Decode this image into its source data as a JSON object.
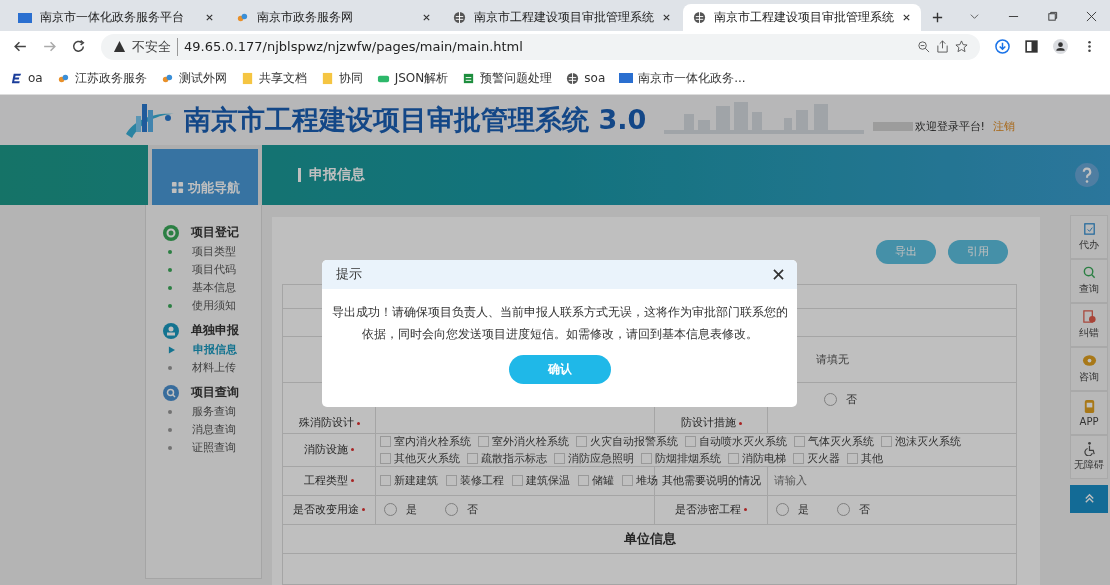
{
  "browser": {
    "tabs": [
      {
        "title": "南京市一体化政务服务平台",
        "selected": false
      },
      {
        "title": "南京市政务服务网",
        "selected": false
      },
      {
        "title": "南京市工程建设项目审批管理系统",
        "selected": false
      },
      {
        "title": "南京市工程建设项目审批管理系统",
        "selected": true
      }
    ],
    "security": "不安全",
    "url": "49.65.0.177/njblspwz/njzwfw/pages/main/main.html",
    "bookmarks": [
      "oa",
      "江苏政务服务",
      "测试外网",
      "共享文档",
      "协同",
      "JSON解析",
      "预警问题处理",
      "soa",
      "南京市一体化政务..."
    ]
  },
  "header": {
    "title": "南京市工程建设项目审批管理系统 3.0",
    "welcome": "欢迎登录平台!",
    "logout": "注销"
  },
  "nav_bar": {
    "heading": "功能导航",
    "section_title": "申报信息"
  },
  "sidebar": {
    "groups": [
      {
        "title": "项目登记",
        "items": [
          {
            "label": "项目类型",
            "selected": false
          },
          {
            "label": "项目代码",
            "selected": false
          },
          {
            "label": "基本信息",
            "selected": false
          },
          {
            "label": "使用须知",
            "selected": false
          }
        ]
      },
      {
        "title": "单独申报",
        "items": [
          {
            "label": "申报信息",
            "selected": true
          },
          {
            "label": "材料上传",
            "selected": false
          }
        ]
      },
      {
        "title": "项目查询",
        "items": [
          {
            "label": "服务查询",
            "selected": false
          },
          {
            "label": "消息查询",
            "selected": false
          },
          {
            "label": "证照查询",
            "selected": false
          }
        ]
      }
    ]
  },
  "actions": [
    "导出",
    "引用"
  ],
  "form": {
    "rows": [
      {
        "value_2": "请填无"
      },
      {
        "label": "殊消防设计",
        "required": true,
        "label_2": "防设计措施",
        "required_2": true,
        "radio": {
          "label": "否",
          "selected": false
        }
      }
    ],
    "fire_facilities": {
      "label": "消防设施",
      "required": true,
      "options": [
        {
          "label": "室内消火栓系统",
          "checked": false
        },
        {
          "label": "室外消火栓系统",
          "checked": false
        },
        {
          "label": "火灾自动报警系统",
          "checked": false
        },
        {
          "label": "自动喷水灭火系统",
          "checked": false
        },
        {
          "label": "气体灭火系统",
          "checked": false
        },
        {
          "label": "泡沫灭火系统",
          "checked": false
        },
        {
          "label": "其他灭火系统",
          "checked": false
        },
        {
          "label": "疏散指示标志",
          "checked": false
        },
        {
          "label": "消防应急照明",
          "checked": false
        },
        {
          "label": "防烟排烟系统",
          "checked": false
        },
        {
          "label": "消防电梯",
          "checked": false
        },
        {
          "label": "灭火器",
          "checked": false
        },
        {
          "label": "其他",
          "checked": false
        }
      ]
    },
    "project_type": {
      "label": "工程类型",
      "required": true,
      "options": [
        {
          "label": "新建建筑",
          "checked": false
        },
        {
          "label": "装修工程",
          "checked": false
        },
        {
          "label": "建筑保温",
          "checked": false
        },
        {
          "label": "储罐",
          "checked": false
        },
        {
          "label": "堆场",
          "checked": false
        }
      ],
      "other_label": "其他需要说明的情况",
      "other_placeholder": "请输入"
    },
    "change_use": {
      "label": "是否改变用途",
      "required": true,
      "options": [
        {
          "label": "是",
          "selected": false
        },
        {
          "label": "否",
          "selected": false
        }
      ]
    },
    "confidential": {
      "label": "是否涉密工程",
      "required": true,
      "options": [
        {
          "label": "是",
          "selected": false
        },
        {
          "label": "否",
          "selected": false
        }
      ]
    },
    "section_title": "单位信息"
  },
  "right_toolbar": [
    "代办",
    "查询",
    "纠错",
    "咨询",
    "APP",
    "无障碍"
  ],
  "modal": {
    "title": "提示",
    "message": "导出成功！请确保项目负责人、当前申报人联系方式无误，这将作为审批部门联系您的依据，同时会向您发送项目进度短信。如需修改，请回到基本信息表修改。",
    "confirm": "确认"
  }
}
